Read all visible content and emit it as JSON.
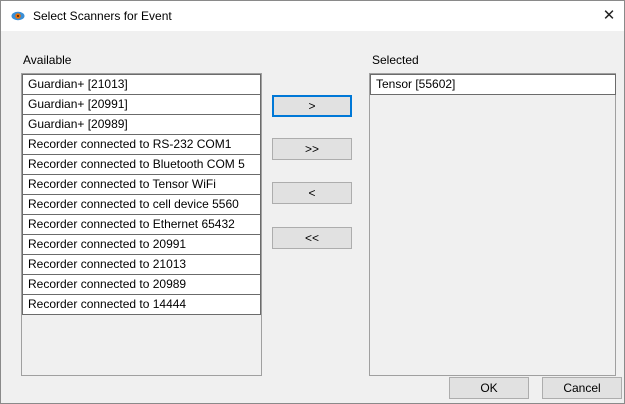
{
  "window": {
    "title": "Select Scanners for Event",
    "close_glyph": "✕",
    "icon": "eye-icon"
  },
  "available": {
    "label": "Available",
    "items": [
      "Guardian+ [21013]",
      "Guardian+ [20991]",
      "Guardian+ [20989]",
      "Recorder connected to RS-232 COM1",
      "Recorder connected to Bluetooth COM 5",
      "Recorder connected to Tensor WiFi",
      "Recorder connected to cell device 5560",
      "Recorder connected to Ethernet 65432",
      "Recorder connected to 20991",
      "Recorder connected to 21013",
      "Recorder connected to 20989",
      "Recorder connected to 14444"
    ]
  },
  "selected": {
    "label": "Selected",
    "items": [
      "Tensor [55602]"
    ]
  },
  "transfer": {
    "add_label": ">",
    "add_all_label": ">>",
    "remove_label": "<",
    "remove_all_label": "<<"
  },
  "footer": {
    "ok_label": "OK",
    "cancel_label": "Cancel"
  },
  "colors": {
    "focus_border": "#0078d7",
    "button_bg": "#e1e1e1",
    "dialog_bg": "#f0f0f0"
  }
}
